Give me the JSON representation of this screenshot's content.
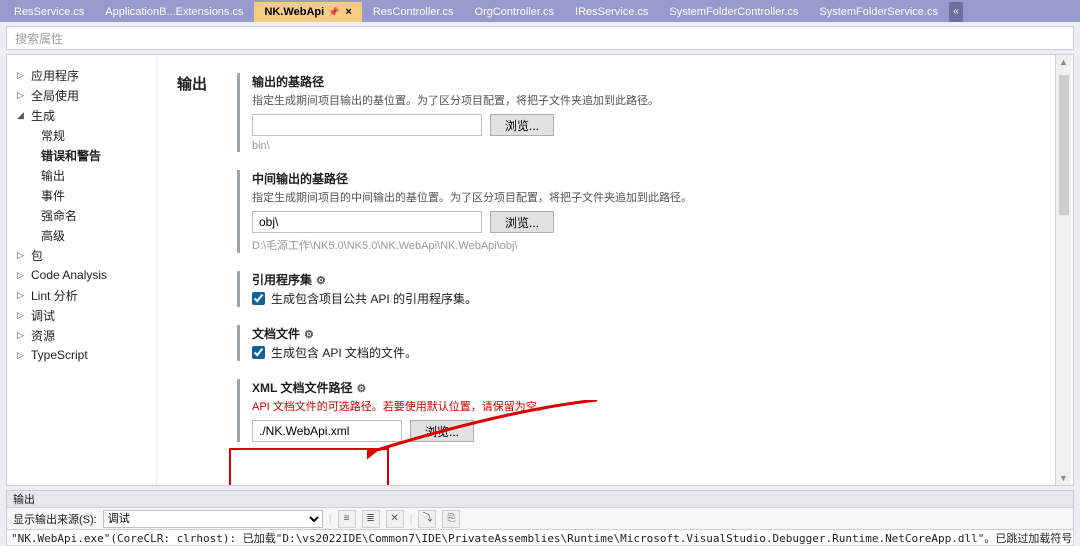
{
  "tabs": [
    {
      "label": "ResService.cs"
    },
    {
      "label": "ApplicationB...Extensions.cs"
    },
    {
      "label": "NK.WebApi",
      "active": true
    },
    {
      "label": "ResController.cs"
    },
    {
      "label": "OrgController.cs"
    },
    {
      "label": "IResService.cs"
    },
    {
      "label": "SystemFolderController.cs"
    },
    {
      "label": "SystemFolderService.cs"
    }
  ],
  "search_placeholder": "搜索属性",
  "sidebar": {
    "items": [
      {
        "label": "应用程序",
        "expandable": true,
        "expanded": false
      },
      {
        "label": "全局使用",
        "expandable": true,
        "expanded": false
      },
      {
        "label": "生成",
        "expandable": true,
        "expanded": true,
        "children": [
          {
            "label": "常规"
          },
          {
            "label": "错误和警告",
            "selected": true
          },
          {
            "label": "输出"
          },
          {
            "label": "事件"
          },
          {
            "label": "强命名"
          },
          {
            "label": "高级"
          }
        ]
      },
      {
        "label": "包",
        "expandable": true,
        "expanded": false
      },
      {
        "label": "Code Analysis",
        "expandable": true,
        "expanded": false
      },
      {
        "label": "Lint 分析",
        "expandable": true,
        "expanded": false
      },
      {
        "label": "调试",
        "expandable": true,
        "expanded": false
      },
      {
        "label": "资源",
        "expandable": true,
        "expanded": false
      },
      {
        "label": "TypeScript",
        "expandable": true,
        "expanded": false
      }
    ]
  },
  "main": {
    "header": "输出",
    "out_base": {
      "title": "输出的基路径",
      "desc": "指定生成期间项目输出的基位置。为了区分项目配置，将把子文件夹追加到此路径。",
      "value": "",
      "hint": "bin\\",
      "browse": "浏览..."
    },
    "int_base": {
      "title": "中间输出的基路径",
      "desc": "指定生成期间项目的中间输出的基位置。为了区分项目配置，将把子文件夹追加到此路径。",
      "value": "obj\\",
      "hint": "D:\\毛源工作\\NK5.0\\NK5.0\\NK.WebApi\\NK.WebApi\\obj\\",
      "browse": "浏览..."
    },
    "ref_asm": {
      "title": "引用程序集",
      "check_label": "生成包含项目公共 API 的引用程序集。"
    },
    "doc_file": {
      "title": "文档文件",
      "check_label": "生成包含 API 文档的文件。"
    },
    "xml_path": {
      "title": "XML 文档文件路径",
      "desc": "API 文档文件的可选路径。若要使用默认位置，请保留为空。",
      "value": "./NK.WebApi.xml",
      "browse": "浏览..."
    }
  },
  "output_panel": {
    "title": "输出",
    "source_label": "显示输出来源(S):",
    "source_value": "调试",
    "log": "\"NK.WebApi.exe\"(CoreCLR: clrhost): 已加载\"D:\\vs2022IDE\\Common7\\IDE\\PrivateAssemblies\\Runtime\\Microsoft.VisualStudio.Debugger.Runtime.NetCoreApp.dll\"。已跳过加载符号。模块进行了优化，并且调试器选项\"仅我的代码\"已启用。"
  }
}
